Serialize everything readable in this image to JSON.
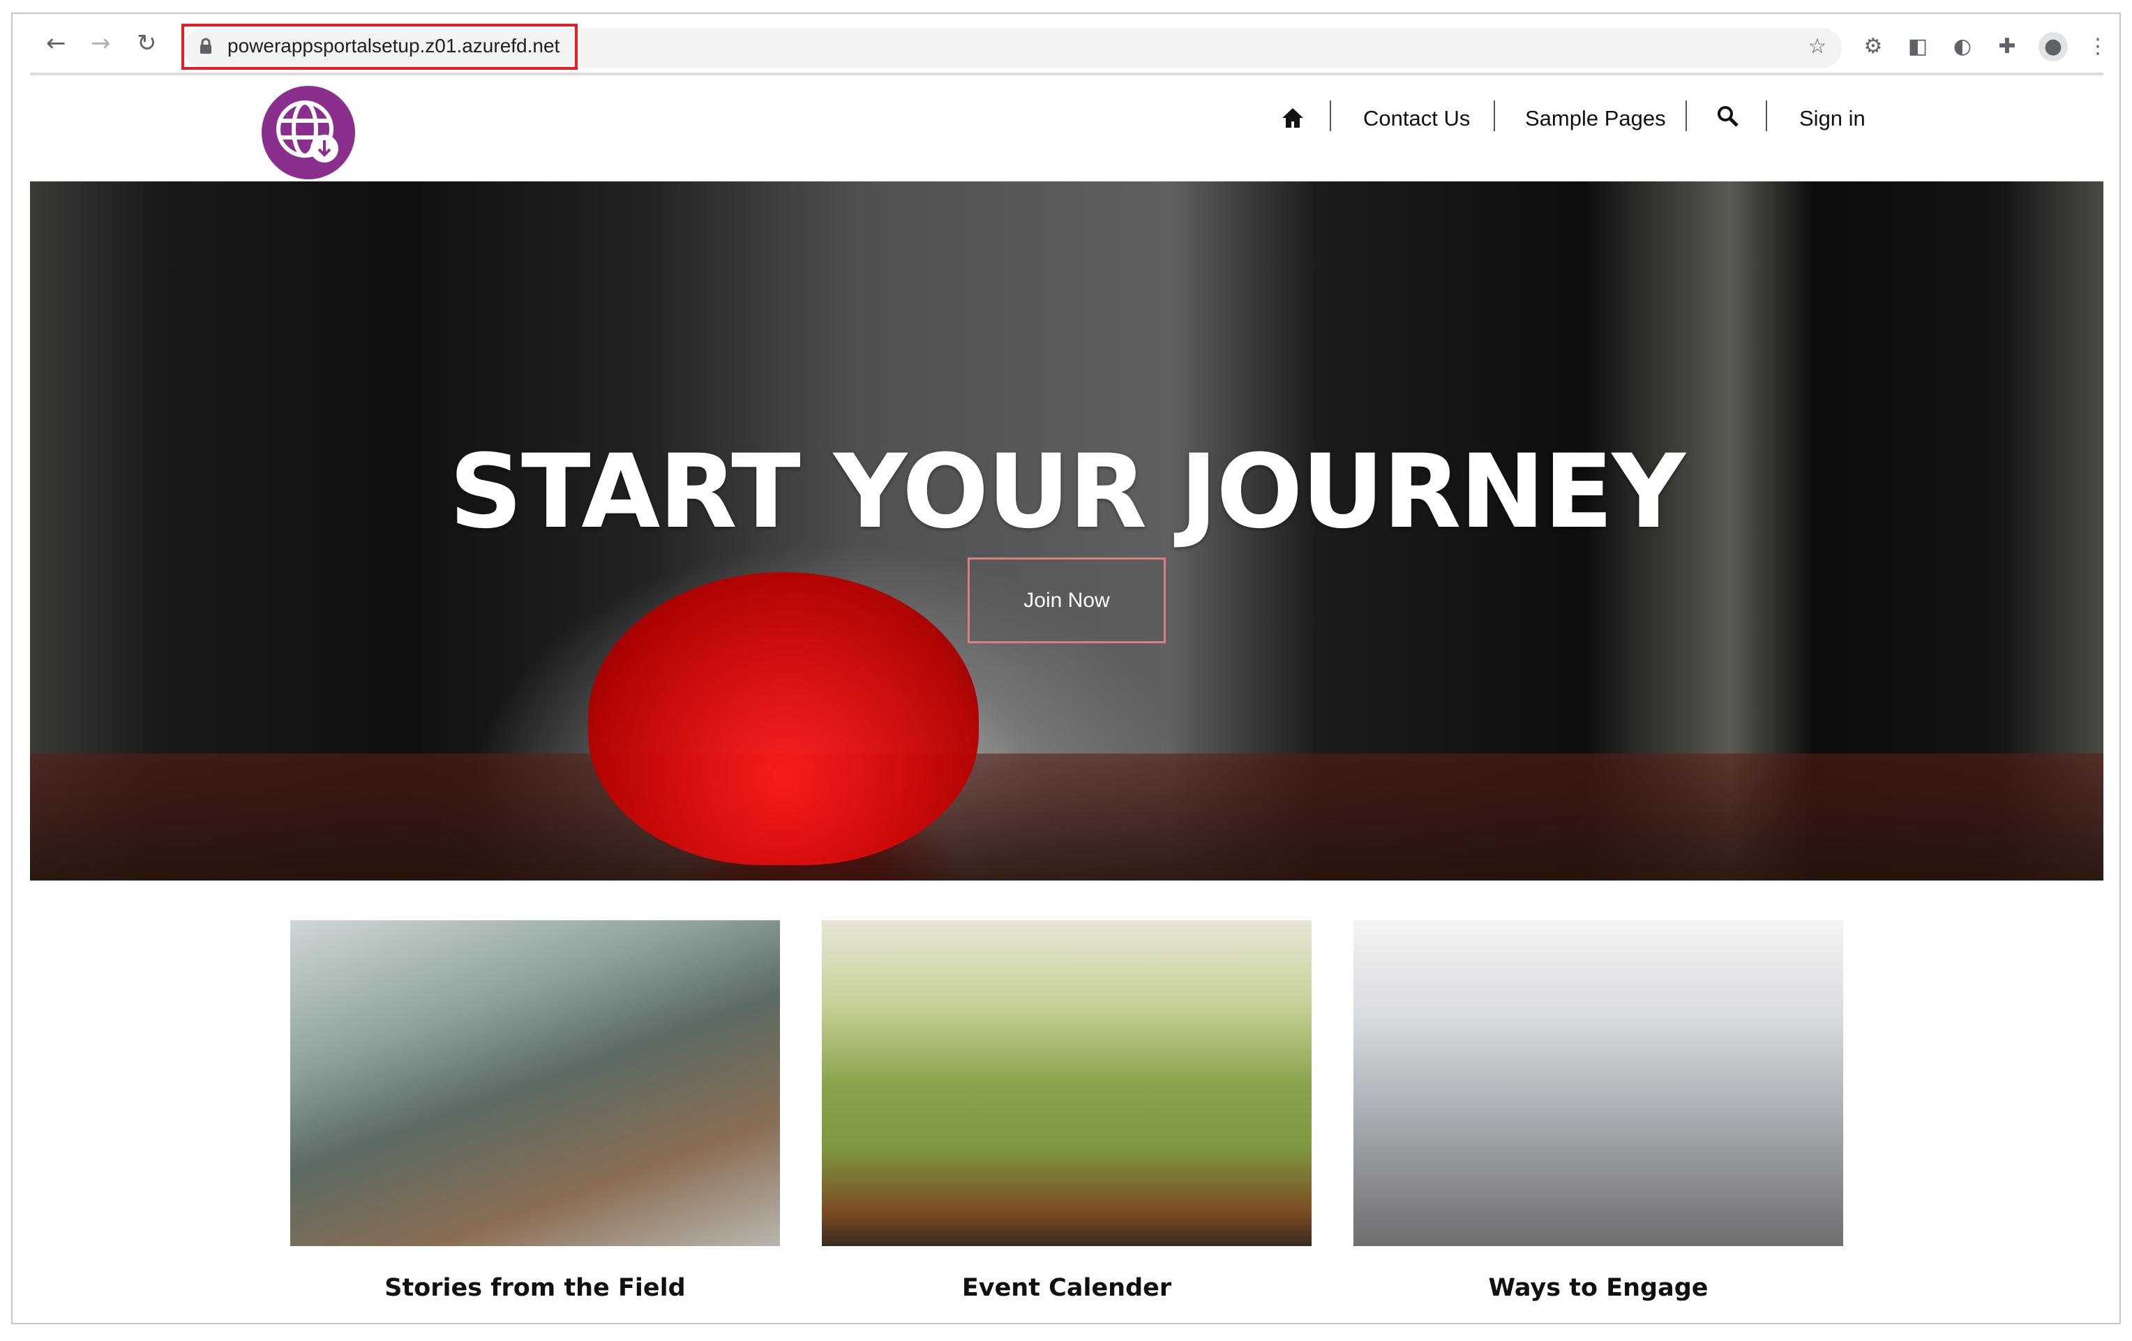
{
  "browser": {
    "url": "powerappsportalsetup.z01.azurefd.net",
    "highlight_color": "#e41e26"
  },
  "site": {
    "brand_color": "#8a2f8e",
    "nav": {
      "contact": "Contact Us",
      "sample": "Sample Pages",
      "signin": "Sign in"
    }
  },
  "hero": {
    "title": "START YOUR JOURNEY",
    "button": "Join Now"
  },
  "cards": [
    {
      "caption": "Stories from the Field"
    },
    {
      "caption": "Event Calender"
    },
    {
      "caption": "Ways to Engage"
    }
  ]
}
